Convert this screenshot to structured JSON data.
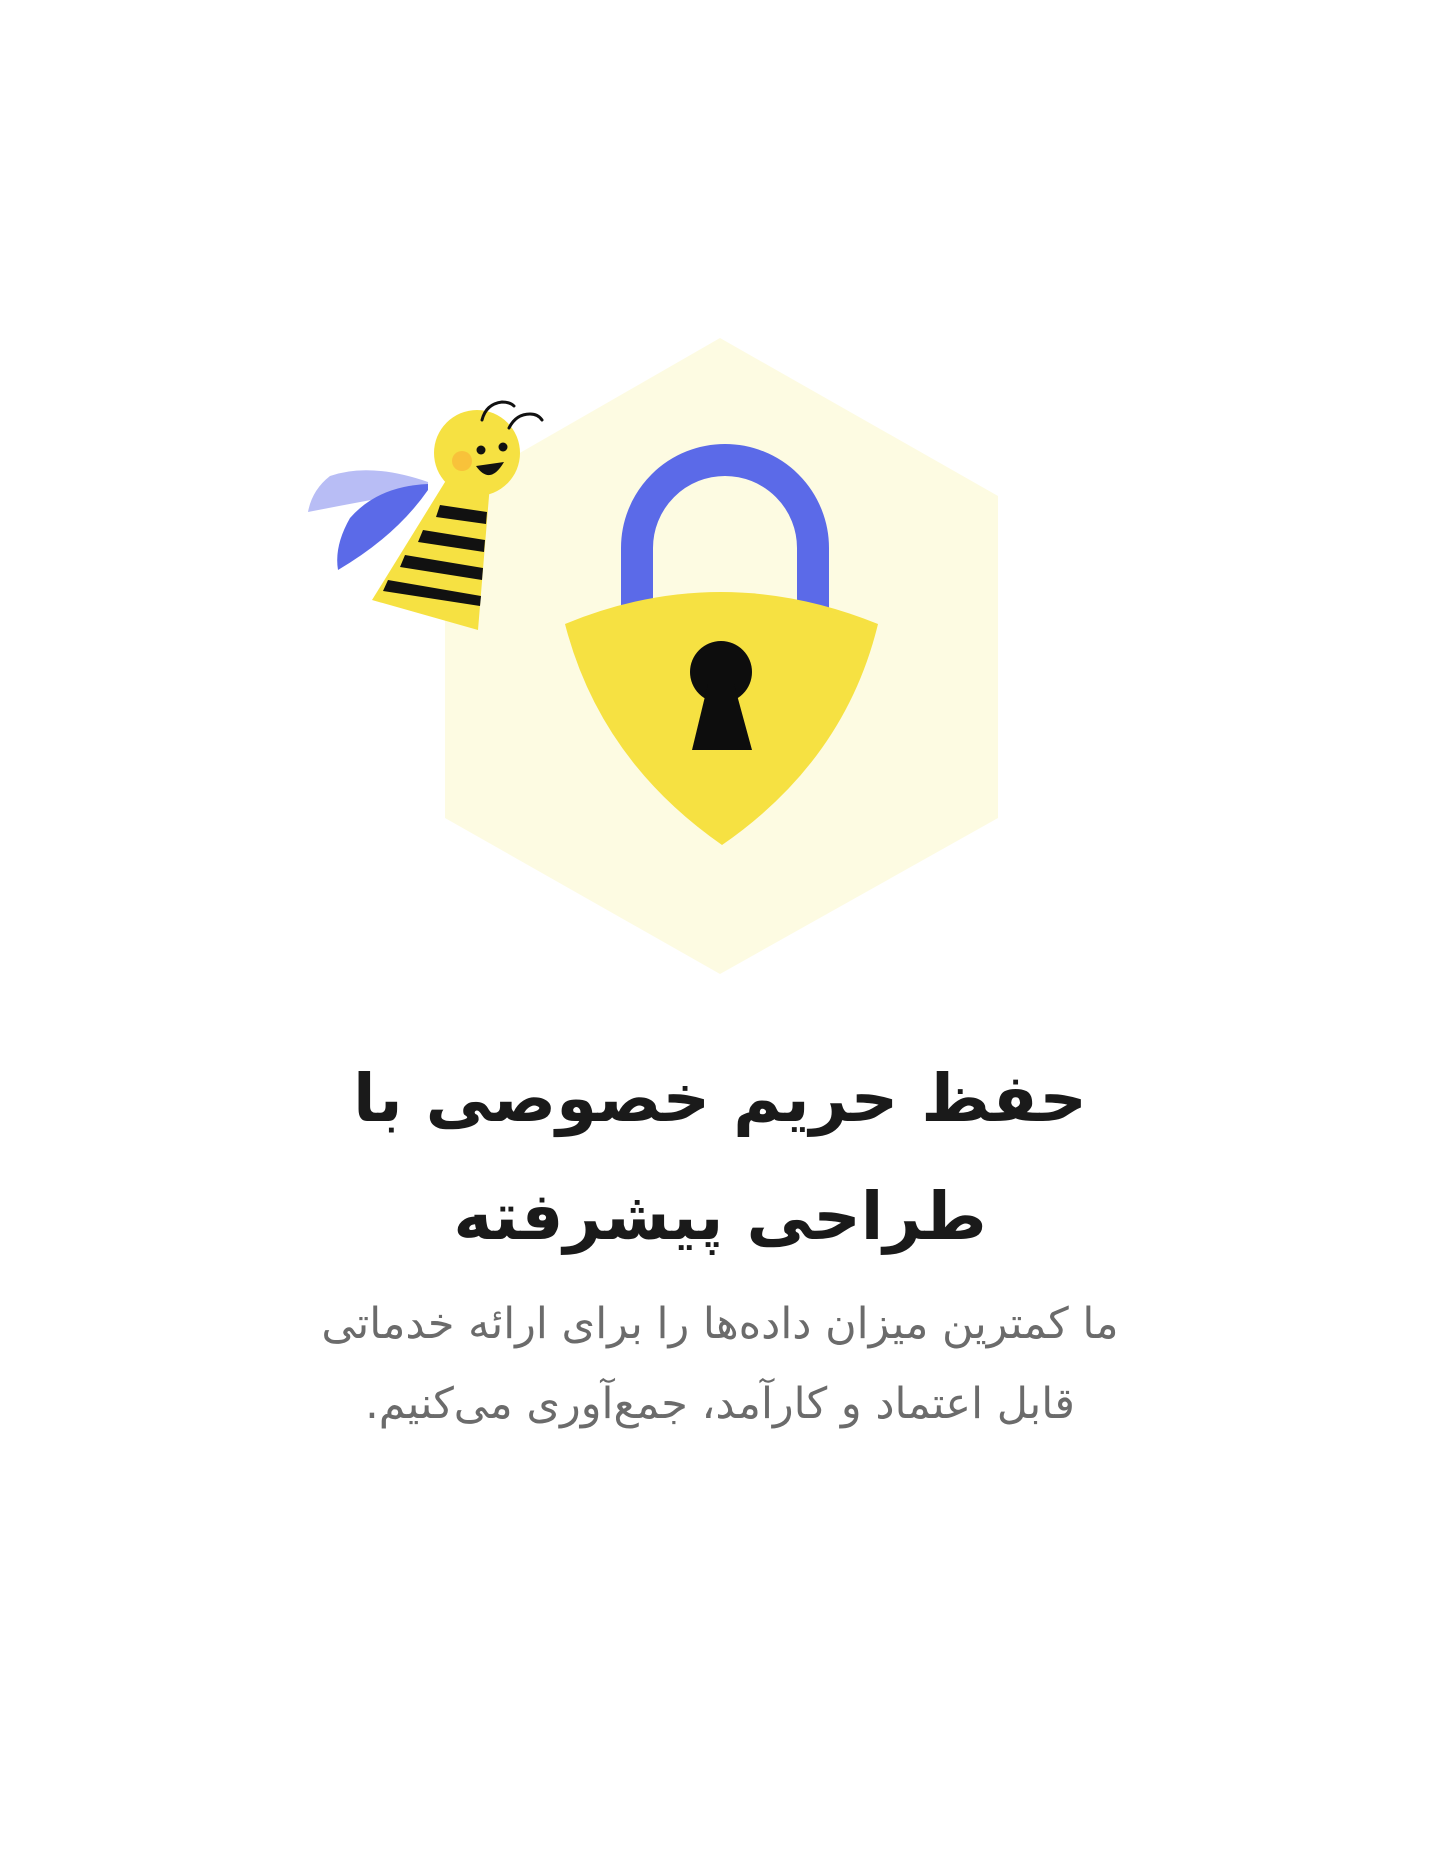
{
  "illustration": {
    "icons": [
      "hexagon-background",
      "bee-icon",
      "padlock-icon",
      "keyhole-icon"
    ],
    "colors": {
      "hexagon": "#fdfbe2",
      "lock_body": "#f6e142",
      "shackle": "#5b6ae8",
      "keyhole": "#0d0d0d",
      "bee_body": "#f6e142",
      "bee_stripes": "#111111",
      "wing_front": "#5b6ae8",
      "wing_back": "#b8bdf5",
      "cheek": "#f8c23a"
    }
  },
  "heading": {
    "line1": "حفظ حریم خصوصی با",
    "line2": "طراحی پیشرفته"
  },
  "description": {
    "line1": "ما کمترین میزان داده‌ها را برای ارائه خدماتی",
    "line2": "قابل اعتماد و کارآمد، جمع‌آوری می‌کنیم."
  }
}
